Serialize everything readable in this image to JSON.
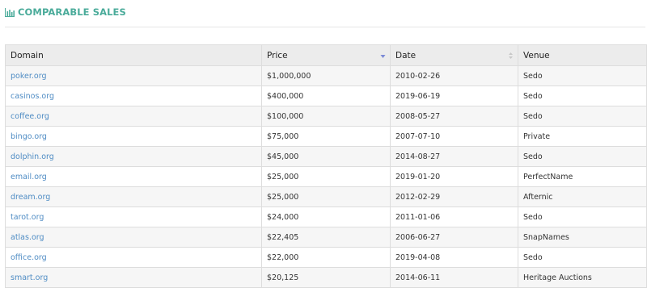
{
  "section": {
    "title": "COMPARABLE SALES",
    "icon": "bar-chart-icon"
  },
  "colors": {
    "accent": "#4aab9a",
    "link": "#4f8cc4",
    "sort_active": "#7b8ad6"
  },
  "table": {
    "columns": [
      {
        "label": "Domain",
        "sort": "none"
      },
      {
        "label": "Price",
        "sort": "descending"
      },
      {
        "label": "Date",
        "sort": "unsorted"
      },
      {
        "label": "Venue",
        "sort": "none"
      }
    ],
    "rows": [
      {
        "domain": "poker.org",
        "price": "$1,000,000",
        "date": "2010-02-26",
        "venue": "Sedo"
      },
      {
        "domain": "casinos.org",
        "price": "$400,000",
        "date": "2019-06-19",
        "venue": "Sedo"
      },
      {
        "domain": "coffee.org",
        "price": "$100,000",
        "date": "2008-05-27",
        "venue": "Sedo"
      },
      {
        "domain": "bingo.org",
        "price": "$75,000",
        "date": "2007-07-10",
        "venue": "Private"
      },
      {
        "domain": "dolphin.org",
        "price": "$45,000",
        "date": "2014-08-27",
        "venue": "Sedo"
      },
      {
        "domain": "email.org",
        "price": "$25,000",
        "date": "2019-01-20",
        "venue": "PerfectName"
      },
      {
        "domain": "dream.org",
        "price": "$25,000",
        "date": "2012-02-29",
        "venue": "Afternic"
      },
      {
        "domain": "tarot.org",
        "price": "$24,000",
        "date": "2011-01-06",
        "venue": "Sedo"
      },
      {
        "domain": "atlas.org",
        "price": "$22,405",
        "date": "2006-06-27",
        "venue": "SnapNames"
      },
      {
        "domain": "office.org",
        "price": "$22,000",
        "date": "2019-04-08",
        "venue": "Sedo"
      },
      {
        "domain": "smart.org",
        "price": "$20,125",
        "date": "2014-06-11",
        "venue": "Heritage Auctions"
      }
    ]
  }
}
